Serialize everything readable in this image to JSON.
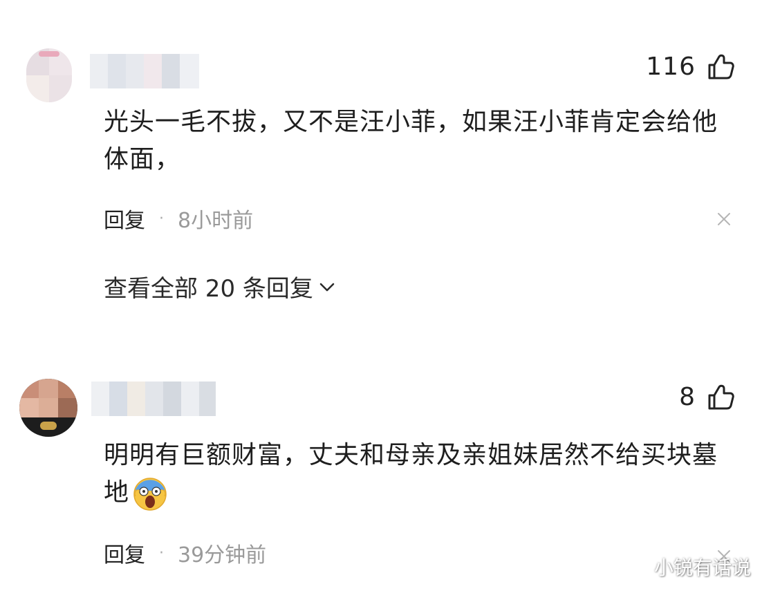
{
  "comments": [
    {
      "likes": "116",
      "text": "光头一毛不拔，又不是汪小菲，如果汪小菲肯定会给他体面，",
      "reply_label": "回复",
      "separator": "·",
      "time": "8小时前",
      "view_all": "查看全部 20 条回复"
    },
    {
      "likes": "8",
      "text": "明明有巨额财富，丈夫和母亲及亲姐妹居然不给买块墓地",
      "reply_label": "回复",
      "separator": "·",
      "time": "39分钟前"
    }
  ],
  "watermark": "小锐有话说",
  "icons": {
    "like": "thumbs-up-icon",
    "close": "close-icon",
    "chevron": "chevron-down-icon",
    "emoji": "screaming-face-emoji"
  },
  "colors": {
    "background": "#ffffff",
    "text": "#1e1e1e",
    "muted": "#9a9a9a"
  }
}
